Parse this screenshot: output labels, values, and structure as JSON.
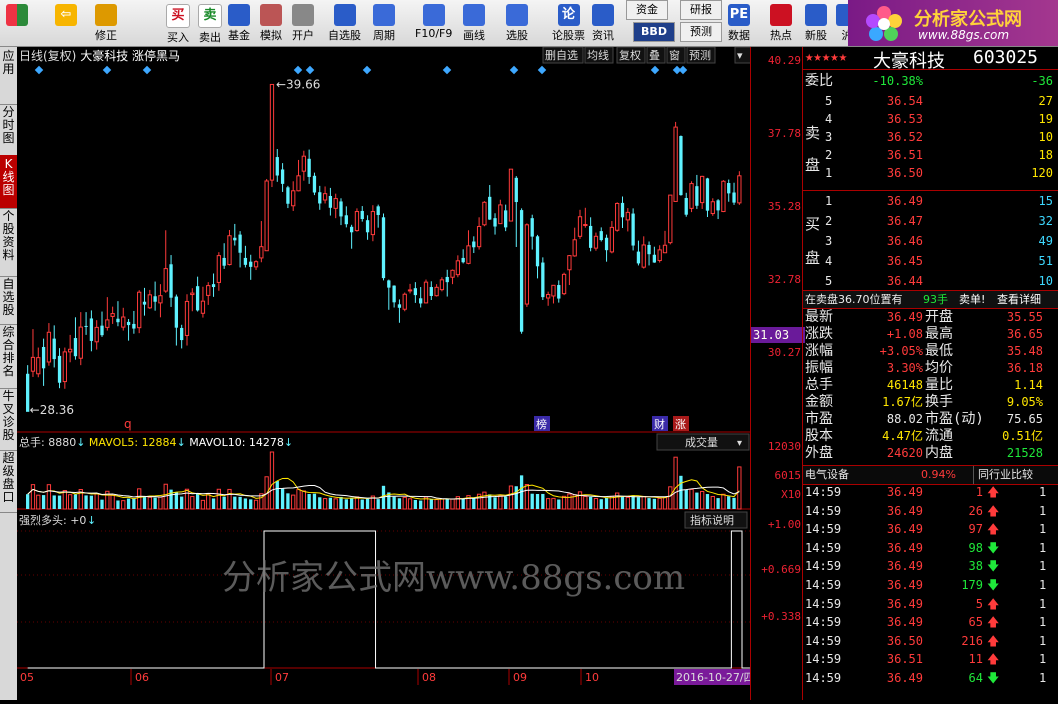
{
  "toolbar": [
    {
      "label": "",
      "icon": "windows-grid-icon"
    },
    {
      "label": "",
      "icon": "back-arrow-icon"
    },
    {
      "label": "修正",
      "icon": "up-down-icon"
    },
    {
      "label": "买入",
      "icon": "buy-icon",
      "glyph": "买"
    },
    {
      "label": "卖出",
      "icon": "sell-icon",
      "glyph": "卖"
    },
    {
      "label": "基金",
      "icon": "fund-icon"
    },
    {
      "label": "模拟",
      "icon": "hammer-icon"
    },
    {
      "label": "开户",
      "icon": "lock-icon"
    },
    {
      "label": "自选股",
      "icon": "star-icon"
    },
    {
      "label": "周期",
      "icon": "clock-icon"
    },
    {
      "label": "F10/F9",
      "icon": "f10-icon"
    },
    {
      "label": "画线",
      "icon": "pen-icon"
    },
    {
      "label": "选股",
      "icon": "chart-icon"
    },
    {
      "label": "论股票",
      "icon": "forum-icon",
      "glyph": "论"
    },
    {
      "label": "资讯",
      "icon": "news-icon"
    },
    {
      "label": "资金",
      "icon": "capital-icon"
    },
    {
      "label": "BBD",
      "icon": "bbd-icon"
    },
    {
      "label": "研报",
      "icon": "research-icon"
    },
    {
      "label": "预测",
      "icon": "forecast-icon"
    },
    {
      "label": "数据",
      "icon": "pe-icon",
      "glyph": "PE"
    },
    {
      "label": "热点",
      "icon": "hot-icon"
    },
    {
      "label": "新股",
      "icon": "ipo-icon"
    },
    {
      "label": "沪",
      "icon": "sh-icon"
    }
  ],
  "logo": {
    "text": "分析家公式网",
    "url": "www.88gs.com"
  },
  "left_tabs": [
    "应用",
    "分时图",
    "K线图",
    "个股资料",
    "自选股",
    "综合排名",
    "牛叉诊股",
    "超级盘口"
  ],
  "chart_header": {
    "title": "日线(复权)",
    "stock": "大豪科技",
    "formula": "涨停黑马"
  },
  "chart_buttons": [
    "删自选",
    "均线",
    "复权",
    "叠",
    "窗",
    "预测",
    "▾"
  ],
  "price_annotations": {
    "high": "39.66",
    "low": "28.36",
    "current": "31.03"
  },
  "markers": {
    "q": "q",
    "bang": "榜",
    "cai": "财",
    "zhang": "涨"
  },
  "vol_header": {
    "label_total": "总手:",
    "total": "8880",
    "label_m5": "MAVOL5:",
    "mavol5": "12884",
    "label_m10": "MAVOL10:",
    "mavol10": "14278",
    "arrow": "↓"
  },
  "vol_dropdown": "成交量",
  "ind_header": "强烈多头: +0",
  "ind_button": "指标说明",
  "watermark": "分析家公式网www.88gs.com",
  "price_axis": [
    "40.29",
    "37.78",
    "35.28",
    "32.78",
    "30.27"
  ],
  "vol_axis": [
    "12030",
    "6015",
    "X10"
  ],
  "ind_axis": [
    "+1.00",
    "+0.669",
    "+0.338"
  ],
  "months": [
    "05",
    "06",
    "07",
    "08",
    "09",
    "10"
  ],
  "date_label": "2016-10-27/四",
  "quote": {
    "stars": "★★★★★",
    "name": "大豪科技",
    "code": "603025",
    "weibi_label": "委比",
    "weibi": "-10.38%",
    "weicha": "-36",
    "sell_label": "卖盘",
    "buy_label": "买盘",
    "sell": [
      [
        "5",
        "36.54",
        "27"
      ],
      [
        "4",
        "36.53",
        "19"
      ],
      [
        "3",
        "36.52",
        "10"
      ],
      [
        "2",
        "36.51",
        "18"
      ],
      [
        "1",
        "36.50",
        "120"
      ]
    ],
    "buy": [
      [
        "1",
        "36.49",
        "15"
      ],
      [
        "2",
        "36.47",
        "32"
      ],
      [
        "3",
        "36.46",
        "49"
      ],
      [
        "4",
        "36.45",
        "51"
      ],
      [
        "5",
        "36.44",
        "10"
      ]
    ],
    "tip_a": "在卖盘36.70位置有",
    "tip_b": "93手",
    "tip_c": "卖单!",
    "tip_d": "查看详细",
    "stats": [
      [
        "最新",
        "36.49",
        "开盘",
        "35.55"
      ],
      [
        "涨跌",
        "+1.08",
        "最高",
        "36.65"
      ],
      [
        "涨幅",
        "+3.05%",
        "最低",
        "35.48"
      ],
      [
        "振幅",
        "3.30%",
        "均价",
        "36.18"
      ],
      [
        "总手",
        "46148",
        "量比",
        "1.14"
      ],
      [
        "金额",
        "1.67亿",
        "换手",
        "9.05%"
      ],
      [
        "市盈",
        "88.02",
        "市盈(动)",
        "75.65"
      ],
      [
        "股本",
        "4.47亿",
        "流通",
        "0.51亿"
      ],
      [
        "外盘",
        "24620",
        "内盘",
        "21528"
      ]
    ],
    "sector": "电气设备",
    "sector_pct": "0.94%",
    "sector_btn": "同行业比较",
    "ticks": [
      [
        "14:59",
        "36.49",
        "1",
        "up"
      ],
      [
        "14:59",
        "36.49",
        "26",
        "up"
      ],
      [
        "14:59",
        "36.49",
        "97",
        "up"
      ],
      [
        "14:59",
        "36.49",
        "98",
        "down"
      ],
      [
        "14:59",
        "36.49",
        "38",
        "down"
      ],
      [
        "14:59",
        "36.49",
        "179",
        "down"
      ],
      [
        "14:59",
        "36.49",
        "5",
        "up"
      ],
      [
        "14:59",
        "36.49",
        "65",
        "up"
      ],
      [
        "14:59",
        "36.50",
        "216",
        "up"
      ],
      [
        "14:59",
        "36.51",
        "11",
        "up"
      ],
      [
        "14:59",
        "36.49",
        "64",
        "down"
      ]
    ]
  },
  "chart_data": {
    "type": "candlestick",
    "ylim": [
      27.6,
      40.3
    ],
    "vlim": [
      0,
      12030
    ],
    "candles": [
      [
        29.62,
        28.3,
        29.92,
        28.36
      ],
      [
        29.71,
        30.19,
        31.17,
        29.51
      ],
      [
        29.62,
        30.18,
        30.53,
        29.5
      ],
      [
        30.55,
        29.81,
        30.84,
        29.2
      ],
      [
        30.03,
        31.06,
        31.38,
        29.9
      ],
      [
        30.84,
        30.13,
        31.3,
        29.84
      ],
      [
        30.24,
        29.31,
        30.51,
        29.12
      ],
      [
        29.35,
        30.38,
        30.53,
        29.1
      ],
      [
        30.38,
        30.47,
        30.97,
        30.02
      ],
      [
        30.86,
        30.23,
        31.58,
        30.11
      ],
      [
        30.16,
        31.24,
        31.76,
        29.92
      ],
      [
        31.28,
        31.27,
        31.76,
        30.97
      ],
      [
        31.54,
        30.76,
        31.82,
        30.4
      ],
      [
        30.73,
        31.23,
        31.48,
        30.46
      ],
      [
        31.29,
        30.96,
        31.78,
        30.9
      ],
      [
        31.23,
        31.49,
        32.28,
        31.12
      ],
      [
        31.61,
        31.71,
        31.95,
        31.35
      ],
      [
        31.53,
        31.41,
        32.14,
        31.27
      ],
      [
        31.24,
        31.59,
        31.91,
        31.12
      ],
      [
        31.42,
        31.31,
        31.52,
        30.77
      ],
      [
        31.35,
        31.19,
        31.8,
        31.01
      ],
      [
        31.22,
        32.45,
        32.52,
        31.03
      ],
      [
        32.12,
        32.02,
        32.6,
        31.64
      ],
      [
        31.91,
        32.36,
        32.53,
        31.87
      ],
      [
        32.31,
        32.12,
        32.82,
        31.81
      ],
      [
        32.08,
        32.33,
        32.73,
        31.58
      ],
      [
        32.49,
        33.27,
        34.6,
        32.43
      ],
      [
        33.42,
        32.26,
        33.74,
        31.94
      ],
      [
        32.3,
        31.22,
        32.37,
        30.6
      ],
      [
        31.21,
        30.79,
        31.32,
        30.5
      ],
      [
        30.95,
        32.13,
        32.38,
        30.6
      ],
      [
        32.37,
        32.42,
        32.59,
        31.79
      ],
      [
        32.66,
        31.82,
        32.99,
        31.78
      ],
      [
        31.72,
        32.14,
        32.64,
        31.57
      ],
      [
        32.34,
        32.68,
        32.8,
        32.01
      ],
      [
        32.73,
        32.63,
        33.1,
        32.29
      ],
      [
        32.79,
        33.72,
        33.84,
        32.5
      ],
      [
        33.64,
        33.37,
        34.15,
        33.26
      ],
      [
        33.41,
        34.41,
        34.61,
        33.38
      ],
      [
        34.34,
        34.25,
        34.82,
        34.07
      ],
      [
        34.45,
        33.82,
        34.57,
        33.31
      ],
      [
        33.64,
        33.4,
        34.06,
        33.31
      ],
      [
        33.51,
        33.33,
        33.75,
        32.88
      ],
      [
        33.33,
        33.51,
        33.56,
        33.22
      ],
      [
        33.64,
        34.03,
        34.92,
        33.49
      ],
      [
        33.89,
        36.31,
        36.38,
        33.89
      ],
      [
        36.34,
        39.66,
        39.66,
        36.1
      ],
      [
        37.14,
        36.5,
        37.42,
        36.28
      ],
      [
        36.71,
        36.21,
        36.93,
        35.93
      ],
      [
        36.09,
        35.52,
        36.14,
        35.37
      ],
      [
        35.45,
        35.97,
        36.3,
        35.27
      ],
      [
        35.97,
        36.49,
        37.04,
        35.95
      ],
      [
        36.65,
        37.17,
        37.36,
        36.32
      ],
      [
        37.08,
        36.45,
        37.4,
        36.21
      ],
      [
        36.49,
        35.91,
        36.6,
        35.82
      ],
      [
        35.92,
        35.53,
        36.14,
        35.31
      ],
      [
        35.65,
        35.87,
        36.12,
        35.53
      ],
      [
        35.79,
        35.38,
        36.07,
        35.11
      ],
      [
        35.36,
        35.7,
        35.87,
        35.02
      ],
      [
        35.6,
        35.08,
        35.71,
        34.78
      ],
      [
        35.12,
        34.81,
        35.43,
        34.7
      ],
      [
        34.72,
        34.53,
        34.79,
        33.96
      ],
      [
        34.59,
        35.25,
        35.36,
        34.55
      ],
      [
        35.27,
        34.99,
        35.44,
        34.9
      ],
      [
        34.95,
        34.53,
        35.12,
        34.27
      ],
      [
        34.45,
        35.25,
        35.47,
        34.22
      ],
      [
        35.43,
        35.13,
        35.49,
        34.69
      ],
      [
        35.05,
        32.94,
        35.18,
        32.86
      ],
      [
        32.86,
        32.61,
        32.89,
        31.84
      ],
      [
        32.68,
        32.1,
        32.69,
        31.92
      ],
      [
        32.03,
        31.91,
        32.2,
        31.39
      ],
      [
        31.86,
        32.38,
        32.44,
        31.79
      ],
      [
        32.5,
        32.53,
        32.74,
        32.41
      ],
      [
        32.59,
        32.35,
        32.8,
        32.08
      ],
      [
        32.24,
        32.06,
        32.63,
        31.92
      ],
      [
        32.08,
        32.8,
        32.89,
        32.06
      ],
      [
        32.63,
        32.32,
        32.83,
        32.18
      ],
      [
        32.33,
        32.62,
        32.73,
        32.3
      ],
      [
        32.54,
        32.88,
        32.97,
        32.48
      ],
      [
        32.98,
        32.8,
        33.23,
        32.3
      ],
      [
        32.97,
        33.21,
        33.24,
        32.73
      ],
      [
        33.06,
        33.54,
        33.73,
        32.97
      ],
      [
        33.64,
        33.49,
        33.94,
        33.45
      ],
      [
        33.45,
        34.06,
        34.6,
        33.42
      ],
      [
        34.21,
        34.01,
        34.39,
        33.81
      ],
      [
        34.03,
        34.73,
        35.05,
        33.93
      ],
      [
        34.79,
        35.57,
        35.61,
        34.74
      ],
      [
        35.76,
        34.97,
        36.17,
        34.96
      ],
      [
        35.02,
        34.73,
        35.19,
        34.45
      ],
      [
        34.83,
        35.48,
        35.66,
        34.83
      ],
      [
        35.29,
        34.7,
        35.49,
        34.57
      ],
      [
        34.92,
        36.72,
        36.72,
        34.92
      ],
      [
        36.42,
        35.58,
        36.48,
        34.02
      ],
      [
        35.3,
        31.08,
        35.36,
        31.01
      ],
      [
        32.04,
        34.79,
        34.84,
        31.94
      ],
      [
        35.02,
        34.38,
        35.14,
        33.93
      ],
      [
        34.39,
        33.35,
        34.44,
        32.93
      ],
      [
        33.48,
        32.28,
        33.66,
        32.18
      ],
      [
        32.25,
        32.37,
        32.47,
        31.98
      ],
      [
        32.32,
        32.69,
        32.7,
        32.06
      ],
      [
        32.7,
        32.23,
        32.86,
        32.09
      ],
      [
        32.4,
        33.07,
        33.13,
        32.35
      ],
      [
        33.23,
        33.72,
        33.74,
        32.7
      ],
      [
        33.71,
        34.27,
        34.69,
        33.68
      ],
      [
        34.39,
        35.07,
        35.31,
        34.3
      ],
      [
        34.8,
        34.8,
        35.38,
        34.69
      ],
      [
        34.75,
        33.99,
        35.05,
        33.87
      ],
      [
        33.98,
        34.39,
        34.52,
        33.89
      ],
      [
        34.57,
        34.26,
        34.7,
        34.21
      ],
      [
        34.34,
        33.91,
        34.45,
        33.51
      ],
      [
        33.85,
        34.7,
        34.92,
        33.8
      ],
      [
        34.6,
        35.53,
        35.57,
        34.55
      ],
      [
        35.55,
        35.05,
        35.77,
        34.68
      ],
      [
        34.96,
        35.22,
        35.37,
        34.56
      ],
      [
        35.18,
        34.07,
        35.36,
        33.9
      ],
      [
        33.86,
        33.45,
        34.24,
        33.38
      ],
      [
        33.32,
        34.09,
        34.39,
        33.27
      ],
      [
        34.09,
        33.77,
        34.21,
        33.38
      ],
      [
        33.75,
        33.48,
        34.03,
        33.47
      ],
      [
        33.55,
        33.92,
        34.08,
        33.48
      ],
      [
        33.82,
        34.08,
        34.58,
        33.81
      ],
      [
        34.17,
        35.82,
        35.82,
        34.11
      ],
      [
        35.6,
        38.18,
        38.36,
        35.61
      ],
      [
        37.87,
        35.82,
        37.89,
        35.8
      ],
      [
        35.72,
        35.14,
        35.9,
        35.07
      ],
      [
        35.36,
        36.22,
        36.3,
        35.23
      ],
      [
        36.13,
        35.45,
        36.52,
        35.34
      ],
      [
        35.56,
        36.47,
        36.49,
        35.34
      ],
      [
        36.4,
        35.28,
        36.42,
        35.06
      ],
      [
        35.18,
        35.59,
        35.71,
        35.1
      ],
      [
        35.64,
        35.29,
        35.68,
        34.99
      ],
      [
        35.25,
        36.3,
        36.34,
        35.23
      ],
      [
        36.24,
        35.88,
        36.36,
        35.59
      ],
      [
        35.91,
        35.56,
        36.25,
        35.48
      ],
      [
        35.55,
        36.49,
        36.65,
        35.48
      ]
    ],
    "volume": [
      3120,
      5140,
      2915,
      2937,
      5131,
      2864,
      2837,
      3898,
      3023,
      3058,
      4114,
      2870,
      2813,
      3193,
      1972,
      3740,
      2891,
      1797,
      1763,
      2203,
      2190,
      4262,
      2522,
      2478,
      2390,
      2555,
      5226,
      4087,
      3532,
      2620,
      4170,
      2633,
      3172,
      1821,
      3234,
      2223,
      4162,
      2591,
      4129,
      2611,
      2558,
      2228,
      2035,
      1842,
      3217,
      6800,
      12030,
      5906,
      4294,
      3307,
      2933,
      4154,
      3813,
      3164,
      3230,
      2473,
      2203,
      2383,
      2146,
      2542,
      2051,
      2369,
      2555,
      1992,
      2155,
      2734,
      2083,
      4893,
      3493,
      2595,
      2265,
      2452,
      2151,
      1908,
      1779,
      2512,
      2052,
      1993,
      2111,
      2144,
      2122,
      2604,
      2146,
      2829,
      2236,
      3118,
      3562,
      3082,
      2465,
      2854,
      2614,
      4853,
      4800,
      7100,
      5166,
      3227,
      3167,
      3176,
      2193,
      2237,
      2001,
      2673,
      3166,
      2995,
      3621,
      2634,
      2556,
      2223,
      2075,
      2329,
      2667,
      3374,
      2717,
      2458,
      2917,
      2490,
      2644,
      2301,
      2146,
      2245,
      2479,
      4683,
      10932,
      7005,
      4040,
      4131,
      3468,
      3701,
      3160,
      2642,
      2300,
      3110,
      2707,
      2365,
      8880
    ],
    "indicator": [
      0,
      0,
      0,
      0,
      0,
      0,
      0,
      0,
      0,
      0,
      0,
      0,
      0,
      0,
      0,
      0,
      0,
      0,
      0,
      0,
      0,
      0,
      0,
      0,
      0,
      0,
      0,
      0,
      0,
      0,
      0,
      0,
      0,
      0,
      0,
      0,
      0,
      0,
      0,
      0,
      0,
      0,
      0,
      0,
      0,
      1,
      1,
      1,
      1,
      1,
      1,
      1,
      1,
      1,
      1,
      1,
      1,
      1,
      1,
      1,
      1,
      1,
      1,
      1,
      1,
      1,
      0,
      0,
      0,
      0,
      0,
      0,
      0,
      0,
      0,
      0,
      0,
      0,
      0,
      0,
      0,
      0,
      0,
      0,
      0,
      0,
      0,
      0,
      0,
      0,
      0,
      0,
      0,
      0,
      0,
      0,
      0,
      0,
      0,
      0,
      0,
      0,
      0,
      0,
      0,
      0,
      0,
      0,
      0,
      0,
      0,
      0,
      0,
      0,
      0,
      0,
      0,
      0,
      0,
      0,
      0,
      0,
      0,
      0,
      0,
      0,
      0,
      0,
      0,
      0,
      0,
      0,
      0,
      1,
      1,
      0,
      0
    ]
  }
}
